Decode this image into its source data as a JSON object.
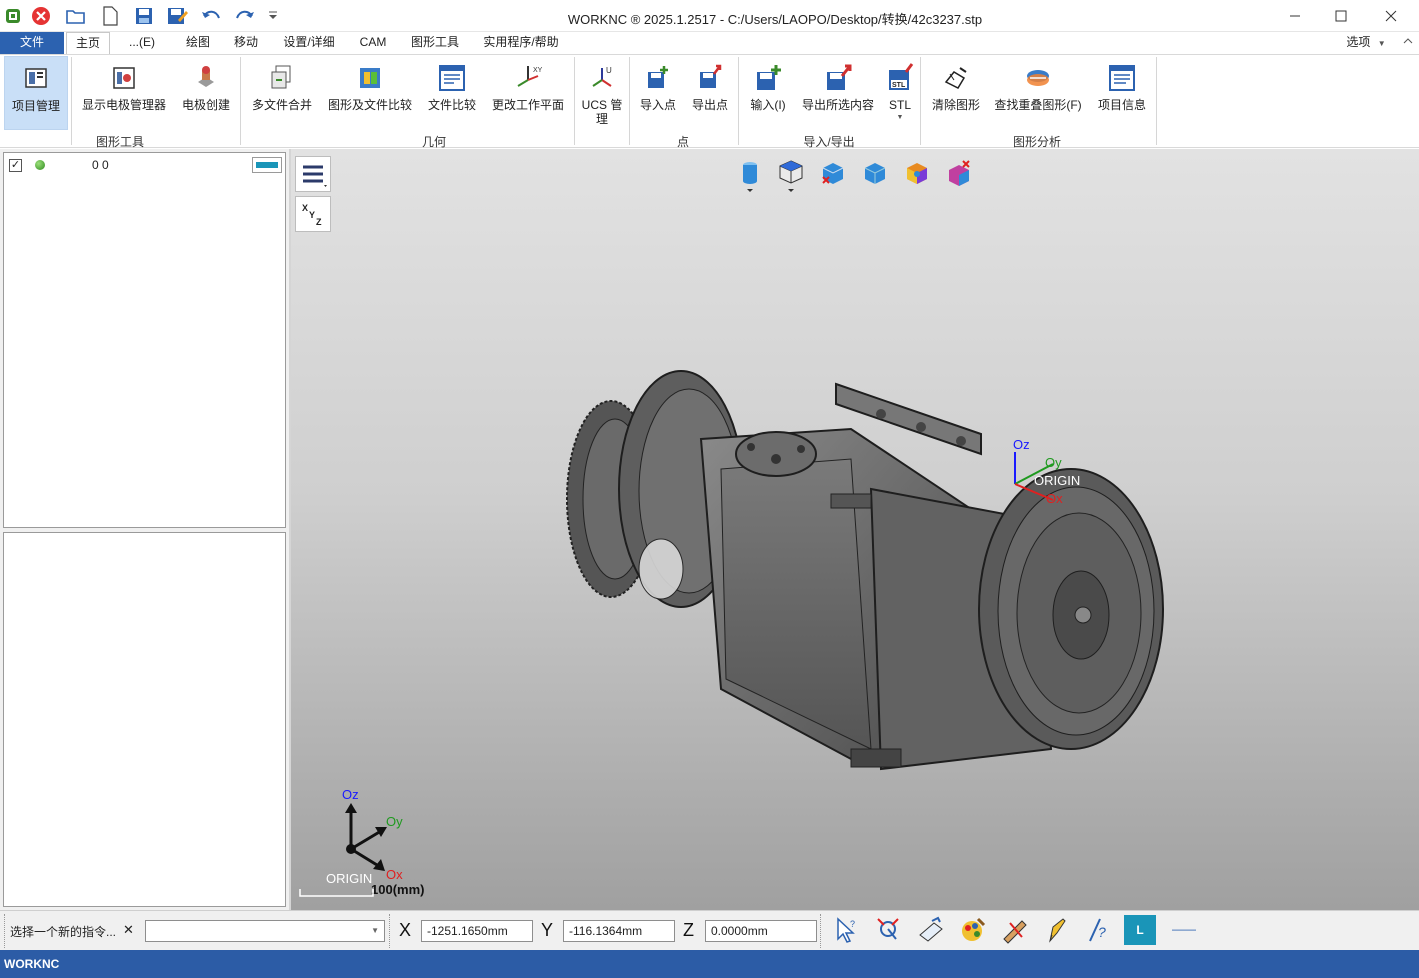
{
  "titlebar": {
    "title": "WORKNC ® 2025.1.2517 - C:/Users/LAOPO/Desktop/转换/42c3237.stp",
    "quick_access": [
      "app-icon",
      "close-red-icon",
      "open-folder-icon",
      "new-file-icon",
      "save-icon",
      "save-as-icon",
      "undo-icon",
      "redo-icon",
      "customize-icon"
    ]
  },
  "menu": {
    "file": "文件",
    "tabs": [
      "主页",
      "...(E)",
      "绘图",
      "移动",
      "设置/详细",
      "CAM",
      "图形工具",
      "实用程序/帮助"
    ],
    "options": "选项"
  },
  "ribbon": {
    "buttons": [
      {
        "label": "项目管理",
        "icon": "project-manager-icon",
        "selected": true
      },
      {
        "label": "显示电极管理器",
        "icon": "electrode-manager-icon"
      },
      {
        "label": "电极创建",
        "icon": "electrode-create-icon"
      },
      {
        "label": "多文件合并",
        "icon": "multi-file-merge-icon"
      },
      {
        "label": "图形及文件比较",
        "icon": "graphic-file-compare-icon"
      },
      {
        "label": "文件比较",
        "icon": "file-compare-icon"
      },
      {
        "label": "更改工作平面",
        "icon": "change-workplane-icon"
      },
      {
        "label": "UCS 管\n理",
        "icon": "ucs-manager-icon"
      },
      {
        "label": "导入点",
        "icon": "import-points-icon"
      },
      {
        "label": "导出点",
        "icon": "export-points-icon"
      },
      {
        "label": "输入(I)",
        "icon": "import-icon"
      },
      {
        "label": "导出所选内容",
        "icon": "export-selection-icon"
      },
      {
        "label": "STL",
        "icon": "stl-icon"
      },
      {
        "label": "清除图形",
        "icon": "clear-graphics-icon"
      },
      {
        "label": "查找重叠图形(F)",
        "icon": "find-overlap-icon"
      },
      {
        "label": "项目信息",
        "icon": "project-info-icon"
      }
    ],
    "groups": [
      "图形工具",
      "几何",
      "点",
      "导入/导出",
      "图形分析"
    ]
  },
  "layer_panel": {
    "row_label": "0  0",
    "checked": true
  },
  "viewport": {
    "origin_label": "ORIGIN",
    "axes": {
      "z": "Oz",
      "y": "Oy",
      "x": "Ox"
    },
    "scale": "100(mm)",
    "model_triad": {
      "z": "Oz",
      "y": "Oy",
      "x": "Ox",
      "label": "ORIGIN"
    }
  },
  "status": {
    "prompt": "选择一个新的指令...",
    "x_label": "X",
    "x_value": "-1251.1650mm",
    "y_label": "Y",
    "y_value": "-116.1364mm",
    "z_label": "Z",
    "z_value": "0.0000mm",
    "layer_button": "L",
    "dash": "——"
  },
  "bottom": {
    "app_name": "WORKNC"
  },
  "colors": {
    "accent": "#2c62b0",
    "selected": "#c9dff7",
    "axis_z": "#1a1aff",
    "axis_y": "#1f9a1f",
    "axis_x": "#e02020"
  }
}
